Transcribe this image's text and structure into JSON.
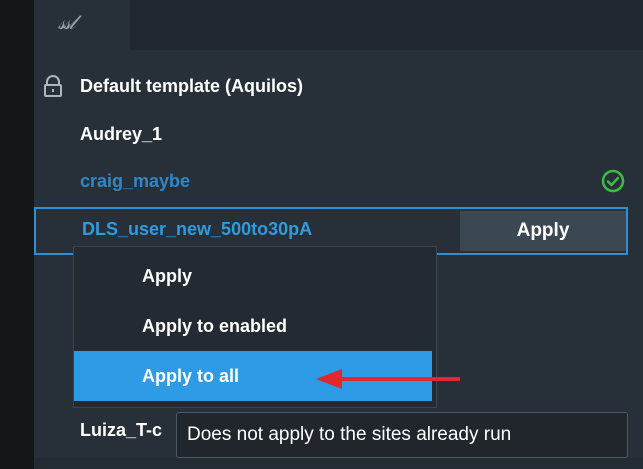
{
  "template_list": {
    "items": [
      {
        "label": "Default template (Aquilos)",
        "locked": true
      },
      {
        "label": "Audrey_1"
      },
      {
        "label": "craig_maybe",
        "color": "#2f86c9",
        "status": "check-circle-icon"
      },
      {
        "label": "DLS_user_new_500to30pA",
        "selected": true
      }
    ],
    "apply_button_label": "Apply",
    "partial_item_label": "Luiza_T-c"
  },
  "context_menu": {
    "items": [
      {
        "label": "Apply"
      },
      {
        "label": "Apply to enabled"
      },
      {
        "label": "Apply to all",
        "highlighted": true
      }
    ]
  },
  "tooltip": {
    "text": "Does not apply to the sites already run"
  },
  "colors": {
    "accent": "#2d9be6",
    "selected_text": "#2f9bdf",
    "check_green": "#3dbb45",
    "arrow_red": "#e0282e"
  }
}
